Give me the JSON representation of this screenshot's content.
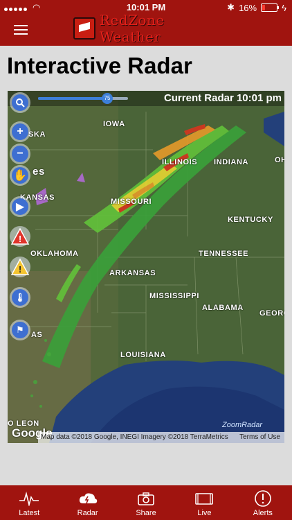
{
  "status_bar": {
    "time": "10:01 PM",
    "battery": "16%"
  },
  "nav": {
    "app_name": "RedZone Weather"
  },
  "page": {
    "title": "Interactive Radar"
  },
  "map": {
    "header": "Current Radar 10:01 pm",
    "slider_value": "75",
    "states": {
      "iowa": "IOWA",
      "illinois": "ILLINOIS",
      "indiana": "INDIANA",
      "ohio": "OH",
      "nebraska": "SKA",
      "kansas": "KANSAS",
      "missouri": "MISSOURI",
      "kentucky": "KENTUCKY",
      "oklahoma": "OKLAHOMA",
      "arkansas": "ARKANSAS",
      "tennessee": "TENNESSEE",
      "mississippi": "MISSISSIPPI",
      "alabama": "ALABAMA",
      "georgia": "GEORG",
      "texas": "AS",
      "louisiana": "LOUISIANA",
      "nuevo_leon": "O LEON",
      "states_fragment": "es"
    },
    "google": "Google",
    "attribution": "Map data ©2018 Google, INEGI Imagery ©2018 TerraMetrics",
    "terms": "Terms of Use",
    "zoomradar": "ZoomRadar"
  },
  "tabs": [
    {
      "label": "Latest",
      "icon": "pulse-icon"
    },
    {
      "label": "Radar",
      "icon": "radar-cloud-icon"
    },
    {
      "label": "Share",
      "icon": "camera-icon"
    },
    {
      "label": "Live",
      "icon": "video-icon"
    },
    {
      "label": "Alerts",
      "icon": "alert-circle-icon"
    }
  ],
  "colors": {
    "brand_red": "#a0140f",
    "accent_blue": "#3e6fd1"
  }
}
